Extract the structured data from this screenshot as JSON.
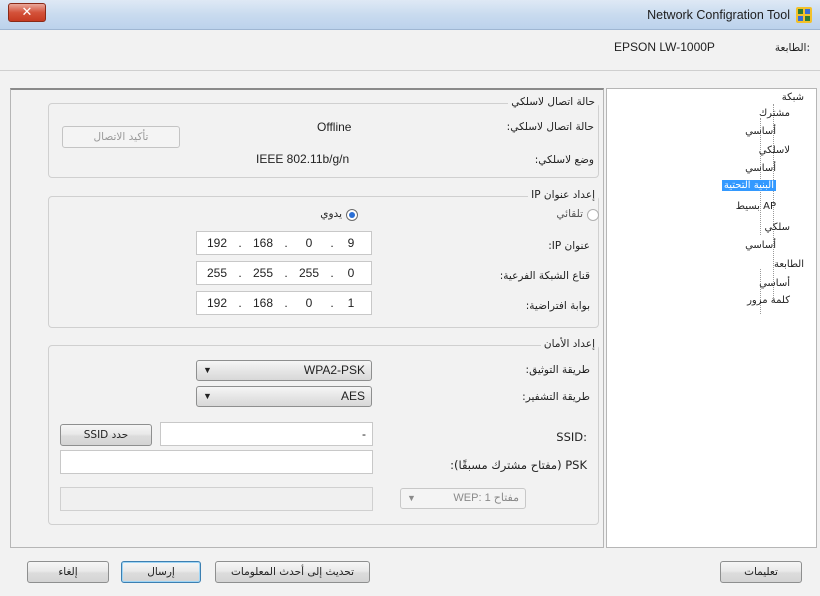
{
  "window": {
    "title": "Network Configration Tool",
    "close_symbol": "✕",
    "app_icon": "network-tool-icon"
  },
  "printer": {
    "label": "الطابعة:",
    "value": "EPSON LW-1000P"
  },
  "tree": {
    "items": [
      {
        "label": "شبكة",
        "level": 0
      },
      {
        "label": "مشترك",
        "level": 1
      },
      {
        "label": "أساسي",
        "level": 2
      },
      {
        "label": "لاسلكي",
        "level": 1
      },
      {
        "label": "أساسي",
        "level": 2
      },
      {
        "label": "البنية التحتية",
        "level": 2,
        "selected": true
      },
      {
        "label": "AP بسيط",
        "level": 2
      },
      {
        "label": "سلكي",
        "level": 1
      },
      {
        "label": "أساسي",
        "level": 2
      },
      {
        "label": "الطابعة",
        "level": 0
      },
      {
        "label": "أساسي",
        "level": 1
      },
      {
        "label": "كلمة مرور",
        "level": 1
      }
    ]
  },
  "wireless_status": {
    "title": "حالة اتصال لاسلكي",
    "state_label": "حالة اتصال لاسلكي:",
    "state_value": "Offline",
    "mode_label": "وضع لاسلكي:",
    "mode_value": "IEEE 802.11b/g/n",
    "confirm_button": "تأكيد الاتصال"
  },
  "ip_setup": {
    "title": "إعداد عنوان IP",
    "auto_label": "تلقائي",
    "manual_label": "يدوي",
    "selected": "manual",
    "ip_label": "عنوان IP:",
    "ip": [
      "192",
      "168",
      "0",
      "9"
    ],
    "mask_label": "قناع الشبكة الفرعية:",
    "mask": [
      "255",
      "255",
      "255",
      "0"
    ],
    "gateway_label": "بوابة افتراضية:",
    "gateway": [
      "192",
      "168",
      "0",
      "1"
    ]
  },
  "security": {
    "title": "إعداد الأمان",
    "auth_label": "طريقة التوثيق:",
    "auth_value": "WPA2-PSK",
    "enc_label": "طريقة التشفير:",
    "enc_value": "AES",
    "ssid_label": ":SSID",
    "ssid_value": "-",
    "ssid_button": "حدد SSID",
    "psk_label": "PSK (مفتاح مشترك مسبقًا):",
    "psk_value": "",
    "wep_select": "مفتاح 1 :WEP",
    "wep_value": ""
  },
  "footer": {
    "help": "تعليمات",
    "refresh": "تحديث إلى أحدث المعلومات",
    "send": "إرسال",
    "cancel": "إلغاء"
  },
  "colors": {
    "selection": "#3399ff",
    "title_bar": "#c9dbef",
    "close_button": "#c63a21"
  }
}
